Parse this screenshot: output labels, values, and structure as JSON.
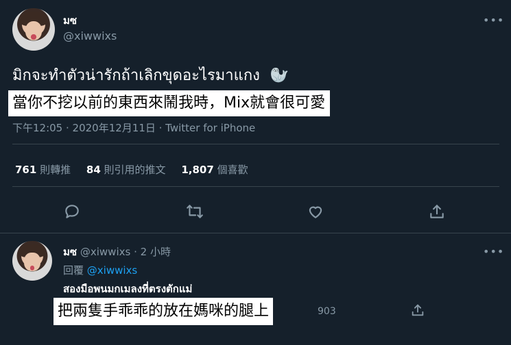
{
  "main_tweet": {
    "display_name": "มซ",
    "handle": "@xiwwixs",
    "thai_text": "มิกจะทำตัวน่ารักถ้าเลิกขุดอะไรมาแกง",
    "emoji": "🦭",
    "caption": "當你不挖以前的東西來鬧我時，Mix就會很可愛",
    "meta": "下午12:05 · 2020年12月11日 · Twitter for iPhone",
    "stats": {
      "retweets_count": "761",
      "retweets_label": "則轉推",
      "quotes_count": "84",
      "quotes_label": "則引用的推文",
      "likes_count": "1,807",
      "likes_label": "個喜歡"
    }
  },
  "reply_tweet": {
    "display_name": "มซ",
    "handle": "@xiwwixs",
    "time": "· 2 小時",
    "reply_prefix": "回覆",
    "reply_to": "@xiwwixs",
    "thai_text": "สองมือพนมกเมลงที่ตรงตักแม่",
    "caption": "把兩隻手乖乖的放在媽咪的腿上",
    "count": "903"
  },
  "colors": {
    "background": "#15202b",
    "muted": "#8899a6",
    "link": "#1da1f2"
  }
}
